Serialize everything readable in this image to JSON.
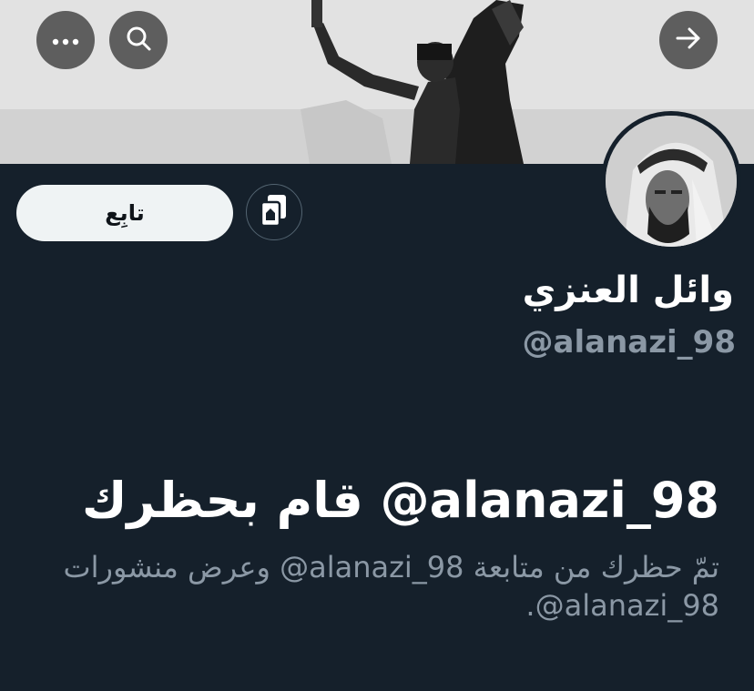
{
  "header": {
    "back_icon": "arrow-right-icon",
    "search_icon": "search-icon",
    "more_icon": "more-horizontal-icon"
  },
  "profile": {
    "display_name": "وائل العنزي",
    "handle": "@alanazi_98",
    "follow_label": "تابِع",
    "copy_icon": "copy-icon"
  },
  "blocked": {
    "title": "alanazi_98@ قام بحظرك",
    "description": "تمّ حظرك من متابعة alanazi_98@ وعرض منشورات alanazi_98@."
  },
  "colors": {
    "background": "#15202b",
    "follow_button_bg": "#eff3f4",
    "secondary_text": "#8b98a5"
  }
}
